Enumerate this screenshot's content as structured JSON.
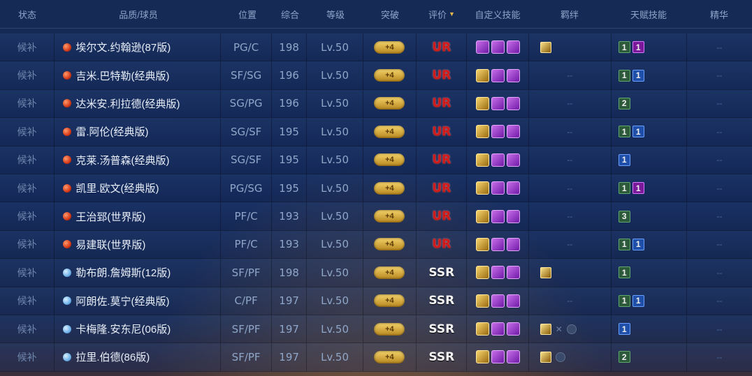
{
  "header": {
    "status": "状态",
    "name": "品质/球员",
    "position": "位置",
    "overall": "综合",
    "level": "等级",
    "breakthrough": "突破",
    "rating": "评价",
    "rating_sort_icon": "triangle-down",
    "custom_skills": "自定义技能",
    "bond": "羁绊",
    "talent": "天赋技能",
    "essence": "精华"
  },
  "colors": {
    "ur_dot": "#d43a1a",
    "ssr_dot": "#6fb2ea",
    "ur_text": "#d01a1a",
    "breakthrough_gold": "#e8c04a"
  },
  "rows": [
    {
      "status": "候补",
      "quality": "ur",
      "name": "埃尔文.约翰逊(87版)",
      "pos": "PG/C",
      "ovr": "198",
      "lvl": "Lv.50",
      "brk": "+4",
      "rating": "UR",
      "skills": [
        "purple",
        "purple",
        "purple"
      ],
      "bond": [
        {
          "type": "gold"
        }
      ],
      "bond_dash": "",
      "talent": [
        {
          "v": "1",
          "c": "green"
        },
        {
          "v": "1",
          "c": "purple"
        }
      ],
      "essence": "--"
    },
    {
      "status": "候补",
      "quality": "ur",
      "name": "吉米.巴特勒(经典版)",
      "pos": "SF/SG",
      "ovr": "196",
      "lvl": "Lv.50",
      "brk": "+4",
      "rating": "UR",
      "skills": [
        "gold",
        "purple",
        "purple"
      ],
      "bond": [],
      "bond_dash": "--",
      "talent": [
        {
          "v": "1",
          "c": "green"
        },
        {
          "v": "1",
          "c": "blue"
        }
      ],
      "essence": "--"
    },
    {
      "status": "候补",
      "quality": "ur",
      "name": "达米安.利拉德(经典版)",
      "pos": "SG/PG",
      "ovr": "196",
      "lvl": "Lv.50",
      "brk": "+4",
      "rating": "UR",
      "skills": [
        "gold",
        "purple",
        "purple"
      ],
      "bond": [],
      "bond_dash": "--",
      "talent": [
        {
          "v": "2",
          "c": "green"
        }
      ],
      "essence": "--"
    },
    {
      "status": "候补",
      "quality": "ur",
      "name": "雷.阿伦(经典版)",
      "pos": "SG/SF",
      "ovr": "195",
      "lvl": "Lv.50",
      "brk": "+4",
      "rating": "UR",
      "skills": [
        "gold",
        "purple",
        "purple"
      ],
      "bond": [],
      "bond_dash": "--",
      "talent": [
        {
          "v": "1",
          "c": "green"
        },
        {
          "v": "1",
          "c": "blue"
        }
      ],
      "essence": "--"
    },
    {
      "status": "候补",
      "quality": "ur",
      "name": "克莱.汤普森(经典版)",
      "pos": "SG/SF",
      "ovr": "195",
      "lvl": "Lv.50",
      "brk": "+4",
      "rating": "UR",
      "skills": [
        "gold",
        "purple",
        "purple"
      ],
      "bond": [],
      "bond_dash": "--",
      "talent": [
        {
          "v": "1",
          "c": "blue"
        }
      ],
      "essence": "--"
    },
    {
      "status": "候补",
      "quality": "ur",
      "name": "凯里.欧文(经典版)",
      "pos": "PG/SG",
      "ovr": "195",
      "lvl": "Lv.50",
      "brk": "+4",
      "rating": "UR",
      "skills": [
        "gold",
        "purple",
        "purple"
      ],
      "bond": [],
      "bond_dash": "--",
      "talent": [
        {
          "v": "1",
          "c": "green"
        },
        {
          "v": "1",
          "c": "purple"
        }
      ],
      "essence": "--"
    },
    {
      "status": "候补",
      "quality": "ur",
      "name": "王治郅(世界版)",
      "pos": "PF/C",
      "ovr": "193",
      "lvl": "Lv.50",
      "brk": "+4",
      "rating": "UR",
      "skills": [
        "gold",
        "purple",
        "purple"
      ],
      "bond": [],
      "bond_dash": "--",
      "talent": [
        {
          "v": "3",
          "c": "green"
        }
      ],
      "essence": "--"
    },
    {
      "status": "候补",
      "quality": "ur",
      "name": "易建联(世界版)",
      "pos": "PF/C",
      "ovr": "193",
      "lvl": "Lv.50",
      "brk": "+4",
      "rating": "UR",
      "skills": [
        "gold",
        "purple",
        "purple"
      ],
      "bond": [],
      "bond_dash": "--",
      "talent": [
        {
          "v": "1",
          "c": "green"
        },
        {
          "v": "1",
          "c": "blue"
        }
      ],
      "essence": "--"
    },
    {
      "status": "候补",
      "quality": "ssr",
      "name": "勒布朗.詹姆斯(12版)",
      "pos": "SF/PF",
      "ovr": "198",
      "lvl": "Lv.50",
      "brk": "+4",
      "rating": "SSR",
      "skills": [
        "gold",
        "purple",
        "purple"
      ],
      "bond": [
        {
          "type": "gold"
        }
      ],
      "bond_dash": "",
      "talent": [
        {
          "v": "1",
          "c": "green"
        }
      ],
      "essence": "--"
    },
    {
      "status": "候补",
      "quality": "ssr",
      "name": "阿朗佐.莫宁(经典版)",
      "pos": "C/PF",
      "ovr": "197",
      "lvl": "Lv.50",
      "brk": "+4",
      "rating": "SSR",
      "skills": [
        "gold",
        "purple",
        "purple"
      ],
      "bond": [],
      "bond_dash": "--",
      "talent": [
        {
          "v": "1",
          "c": "green"
        },
        {
          "v": "1",
          "c": "blue"
        }
      ],
      "essence": "--"
    },
    {
      "status": "候补",
      "quality": "ssr",
      "name": "卡梅隆.安东尼(06版)",
      "pos": "SF/PF",
      "ovr": "197",
      "lvl": "Lv.50",
      "brk": "+4",
      "rating": "SSR",
      "skills": [
        "gold",
        "purple",
        "purple"
      ],
      "bond": [
        {
          "type": "gold"
        },
        {
          "type": "x"
        },
        {
          "type": "dim"
        }
      ],
      "bond_dash": "",
      "talent": [
        {
          "v": "1",
          "c": "blue"
        }
      ],
      "essence": "--"
    },
    {
      "status": "候补",
      "quality": "ssr",
      "name": "拉里.伯德(86版)",
      "pos": "SF/PF",
      "ovr": "197",
      "lvl": "Lv.50",
      "brk": "+4",
      "rating": "SSR",
      "skills": [
        "gold",
        "purple",
        "purple"
      ],
      "bond": [
        {
          "type": "gold"
        },
        {
          "type": "dim"
        }
      ],
      "bond_dash": "",
      "talent": [
        {
          "v": "2",
          "c": "green"
        }
      ],
      "essence": "--"
    }
  ]
}
